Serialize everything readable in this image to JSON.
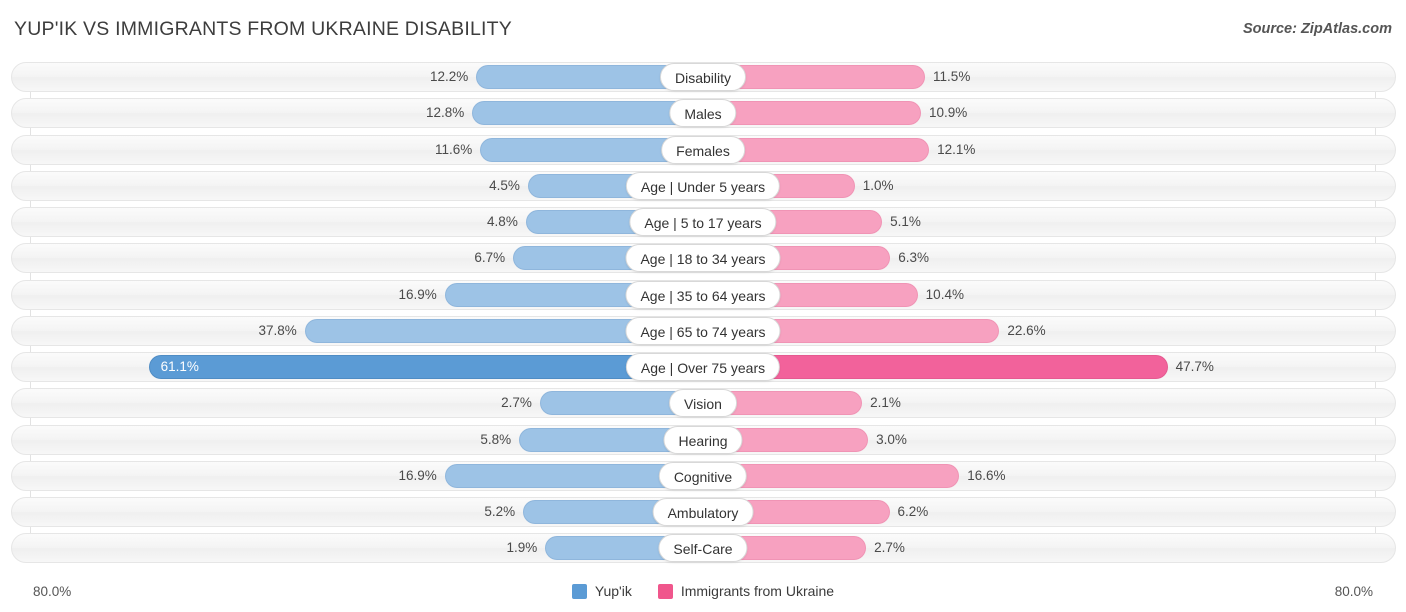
{
  "header": {
    "title": "YUP'IK VS IMMIGRANTS FROM UKRAINE DISABILITY",
    "source": "Source: ZipAtlas.com"
  },
  "axis": {
    "left_max_label": "80.0%",
    "right_max_label": "80.0%",
    "max": 80.0
  },
  "legend": {
    "items": [
      {
        "label": "Yup'ik",
        "color": "#5B9BD5"
      },
      {
        "label": "Immigrants from Ukraine",
        "color": "#F0568C"
      }
    ]
  },
  "colors": {
    "left_bar": "#9DC3E6",
    "right_bar": "#F7A1C0",
    "left_bar_highlight": "#5B9BD5",
    "right_bar_highlight": "#F2629B",
    "track": "#F4F4F4",
    "gridline": "#E2E2E2"
  },
  "chart_data": {
    "type": "bar",
    "orientation": "horizontal-diverging",
    "title": "YUP'IK VS IMMIGRANTS FROM UKRAINE DISABILITY",
    "xlabel": "",
    "ylabel": "",
    "xlim": [
      80.0,
      80.0
    ],
    "grid": true,
    "legend_position": "bottom-center",
    "categories": [
      "Disability",
      "Males",
      "Females",
      "Age | Under 5 years",
      "Age | 5 to 17 years",
      "Age | 18 to 34 years",
      "Age | 35 to 64 years",
      "Age | 65 to 74 years",
      "Age | Over 75 years",
      "Vision",
      "Hearing",
      "Cognitive",
      "Ambulatory",
      "Self-Care"
    ],
    "series": [
      {
        "name": "Yup'ik",
        "side": "left",
        "values": [
          12.2,
          12.8,
          11.6,
          4.5,
          4.8,
          6.7,
          16.9,
          37.8,
          61.1,
          2.7,
          5.8,
          16.9,
          5.2,
          1.9
        ],
        "labels": [
          "12.2%",
          "12.8%",
          "11.6%",
          "4.5%",
          "4.8%",
          "6.7%",
          "16.9%",
          "37.8%",
          "61.1%",
          "2.7%",
          "5.8%",
          "16.9%",
          "5.2%",
          "1.9%"
        ]
      },
      {
        "name": "Immigrants from Ukraine",
        "side": "right",
        "values": [
          11.5,
          10.9,
          12.1,
          1.0,
          5.1,
          6.3,
          10.4,
          22.6,
          47.7,
          2.1,
          3.0,
          16.6,
          6.2,
          2.7
        ],
        "labels": [
          "11.5%",
          "10.9%",
          "12.1%",
          "1.0%",
          "5.1%",
          "6.3%",
          "10.4%",
          "22.6%",
          "47.7%",
          "2.1%",
          "3.0%",
          "16.6%",
          "6.2%",
          "2.7%"
        ]
      }
    ],
    "highlight_rows": [
      8
    ]
  }
}
